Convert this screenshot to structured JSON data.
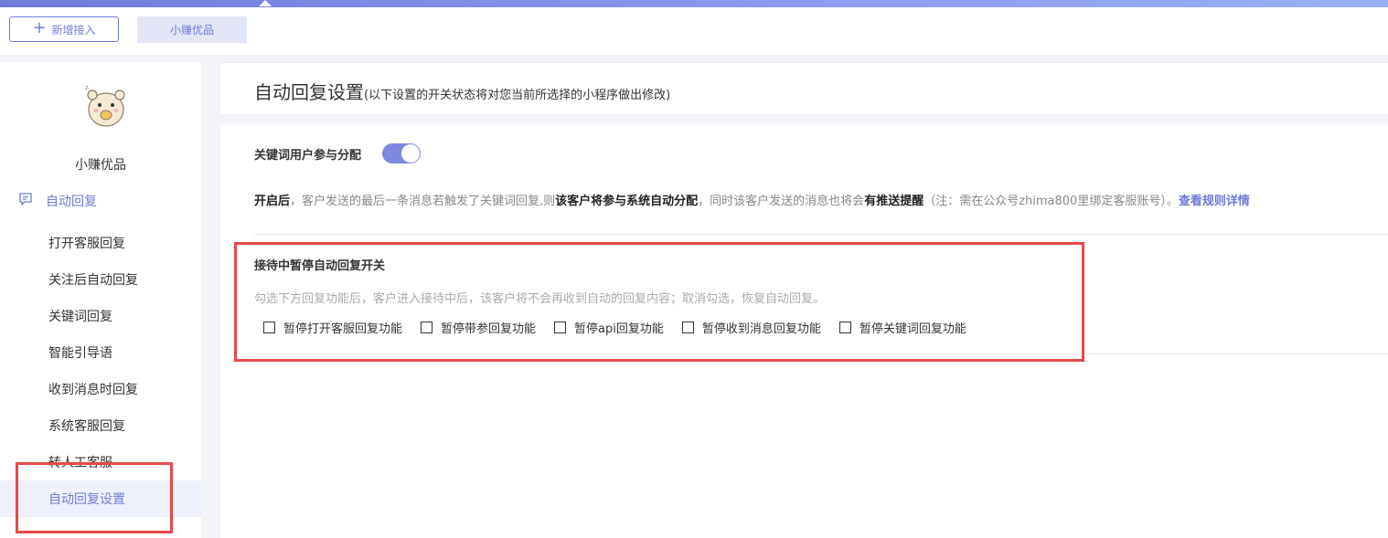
{
  "topbar": {
    "add_label": "新增接入",
    "active_tab": "小赚优品"
  },
  "sidebar": {
    "avatar_icon": "hamster-icon",
    "app_name": "小赚优品",
    "parent_label": "自动回复",
    "items": [
      {
        "label": "打开客服回复"
      },
      {
        "label": "关注后自动回复"
      },
      {
        "label": "关键词回复"
      },
      {
        "label": "智能引导语"
      },
      {
        "label": "收到消息时回复"
      },
      {
        "label": "系统客服回复"
      },
      {
        "label": "转人工客服"
      },
      {
        "label": "自动回复设置",
        "active": true
      }
    ]
  },
  "main": {
    "title": "自动回复设置",
    "subtitle": "(以下设置的开关状态将对您当前所选择的小程序做出修改)",
    "keyword_toggle_label": "关键词用户参与分配",
    "keyword_toggle_on": true,
    "desc": {
      "p1": "开启后",
      "p2": "，客户发送的最后一条消息若触发了关键词回复,则",
      "p3": "该客户将参与系统自动分配",
      "p4": "，同时该客户发送的消息也将会",
      "p5": "有推送提醒",
      "p6": "（注：需在公众号zhima800里绑定客服账号）。",
      "link": "查看规则详情"
    },
    "pause_section": {
      "title": "接待中暂停自动回复开关",
      "desc": "勾选下方回复功能后，客户进入接待中后，该客户将不会再收到自动的回复内容；取消勾选，恢复自动回复。",
      "options": [
        {
          "label": "暂停打开客服回复功能",
          "checked": false
        },
        {
          "label": "暂停带参回复功能",
          "checked": false
        },
        {
          "label": "暂停api回复功能",
          "checked": false
        },
        {
          "label": "暂停收到消息回复功能",
          "checked": false
        },
        {
          "label": "暂停关键词回复功能",
          "checked": false
        }
      ]
    }
  },
  "colors": {
    "accent": "#6f7bd9",
    "highlight": "#e84848"
  }
}
